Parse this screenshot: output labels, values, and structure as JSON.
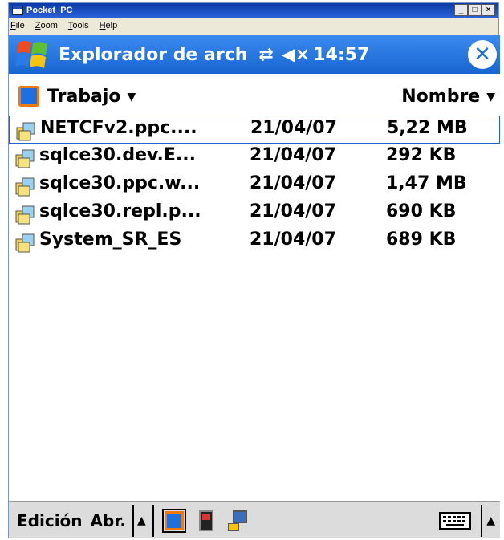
{
  "host": {
    "title": "Pocket_PC",
    "menu": [
      "File",
      "Zoom",
      "Tools",
      "Help"
    ],
    "controls": [
      "_",
      "□",
      "×"
    ]
  },
  "nav": {
    "title": "Explorador de arch",
    "time": "14:57",
    "connect_icon": "connection-arrows-icon",
    "volume_icon": "speaker-muted-icon",
    "close_icon": "close-icon"
  },
  "folder": {
    "name": "Trabajo",
    "sort": "Nombre"
  },
  "files": [
    {
      "name": "NETCFv2.ppc....",
      "date": "21/04/07",
      "size": "5,22 MB",
      "selected": true
    },
    {
      "name": "sqlce30.dev.E...",
      "date": "21/04/07",
      "size": "292 KB"
    },
    {
      "name": "sqlce30.ppc.w...",
      "date": "21/04/07",
      "size": "1,47 MB"
    },
    {
      "name": "sqlce30.repl.p...",
      "date": "21/04/07",
      "size": "690 KB"
    },
    {
      "name": "System_SR_ES",
      "date": "21/04/07",
      "size": "689 KB"
    }
  ],
  "bottom": {
    "edit": "Edición",
    "open": "Abr."
  },
  "colors": {
    "nav_blue": "#1e73e0",
    "selection_border": "#2060d0"
  }
}
